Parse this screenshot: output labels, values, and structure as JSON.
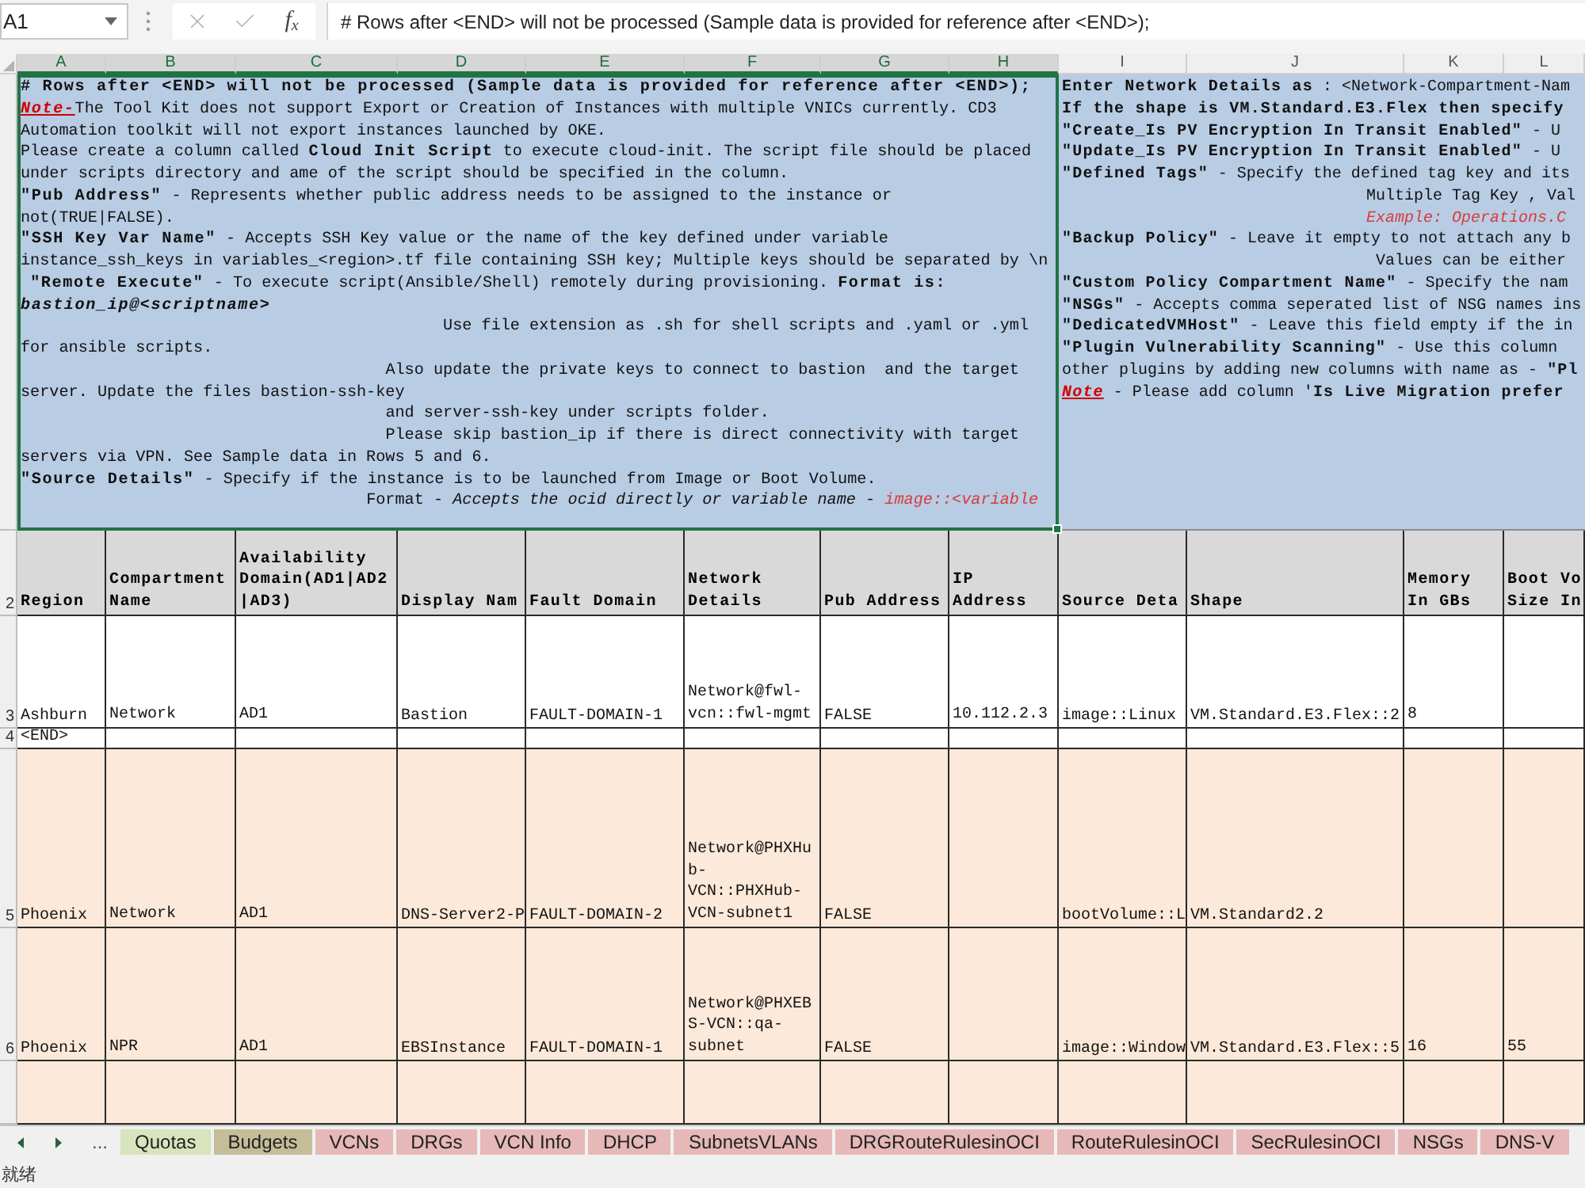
{
  "formula_bar": {
    "name_box": "A1",
    "editing": false,
    "function_label": "f$_{x}$",
    "formula": "# Rows after <END> will not be processed (Sample data is provided for reference after <END>);"
  },
  "columns": [
    {
      "letter": "A",
      "selected": true,
      "heading": "Region"
    },
    {
      "letter": "B",
      "selected": true,
      "wrap": true,
      "heading": "Compartment Name"
    },
    {
      "letter": "C",
      "selected": true,
      "wrap": true,
      "heading": "Availability Domain(AD1|AD2|AD3)"
    },
    {
      "letter": "D",
      "selected": true,
      "wrap": false,
      "heading": "Display Nam"
    },
    {
      "letter": "E",
      "selected": true,
      "heading": "Fault Domain"
    },
    {
      "letter": "F",
      "selected": true,
      "wrap": true,
      "heading": "Network Details"
    },
    {
      "letter": "G",
      "selected": true,
      "heading": "Pub Address"
    },
    {
      "letter": "H",
      "selected": true,
      "wrap": true,
      "heading": "IP Address"
    },
    {
      "letter": "I",
      "selected": false,
      "wrap": false,
      "heading": "Source Deta"
    },
    {
      "letter": "J",
      "selected": false,
      "heading": "Shape"
    },
    {
      "letter": "K",
      "selected": false,
      "wrap": true,
      "heading": "Memory In GBs"
    },
    {
      "letter": "L",
      "selected": false,
      "wrap": true,
      "heading": "Boot Vo Size In"
    }
  ],
  "notes": [
    {
      "selected": true,
      "wrap": true,
      "paragraphs": [
        {
          "runs": [
            {
              "kind": "heading",
              "text": "# Rows after <END> will not be processed (Sample data is provided for reference after <END>);"
            }
          ]
        },
        {
          "runs": [
            {
              "kind": "alert",
              "text": "Note-"
            },
            {
              "kind": "text",
              "text": "The Tool Kit does not support Export or Creation of Instances with multiple VNICs currently. CD3 Automation toolkit will not export instances launched by OKE."
            }
          ]
        },
        {
          "runs": [
            {
              "kind": "text",
              "text": "Please create a column called **Cloud Init Script** to execute cloud-init. The script file should be placed under scripts directory and ame of the script should be specified in the column."
            }
          ]
        },
        {
          "runs": [
            {
              "kind": "text",
              "text": "**\"Pub Address\"** - Represents whether public address needs to be assigned to the instance or not(TRUE|FALSE)."
            }
          ]
        },
        {
          "runs": [
            {
              "kind": "text",
              "text": "**\"SSH Key Var Name\"** - Accepts SSH Key value or the name of the key defined under variable instance_ssh_keys in variables_<region>.tf file containing SSH key; Multiple keys should be separated by \\n"
            }
          ]
        },
        {
          "runs": [
            {
              "kind": "text",
              "text": " **\"Remote Execute\"** - To execute script(Ansible/Shell) remotely during provisioning. **Format is:** "
            },
            {
              "kind": "emphasis",
              "text": "bastion_ip@<scriptname>"
            }
          ]
        },
        {
          "runs": [
            {
              "kind": "text",
              "text": "                                            Use file extension as .sh for shell scripts and .yaml or .yml for ansible scripts."
            }
          ]
        },
        {
          "runs": [
            {
              "kind": "text",
              "text": "                                      Also update the private keys to connect to bastion  and the target server. Update the files bastion-ssh-key"
            }
          ]
        },
        {
          "runs": [
            {
              "kind": "text",
              "text": "                                      and server-ssh-key under scripts folder."
            }
          ]
        },
        {
          "runs": [
            {
              "kind": "text",
              "text": "                                      Please skip bastion_ip if there is direct connectivity with target servers via VPN. See Sample data in Rows 5 and 6."
            }
          ]
        },
        {
          "runs": [
            {
              "kind": "text",
              "text": "**\"Source Details\"** - Specify if the instance is to be launched from Image or Boot Volume."
            }
          ]
        },
        {
          "runs": [
            {
              "kind": "text",
              "text": "                                    Format - *Accepts the ocid directly or variable name* - "
            },
            {
              "kind": "example",
              "text": "image::<variable"
            }
          ]
        }
      ]
    },
    {
      "selected": false,
      "wrap": false,
      "paragraphs": [
        {
          "runs": [
            {
              "kind": "text",
              "text": "**Enter Network Details as** : <Network-Compartment-Nam"
            }
          ]
        },
        {
          "runs": [
            {
              "kind": "heading",
              "text": "If the shape is VM.Standard.E3.Flex then specify"
            }
          ]
        },
        {
          "runs": [
            {
              "kind": "text",
              "text": "**\"Create_Is PV Encryption In Transit Enabled\"** - U"
            }
          ]
        },
        {
          "runs": [
            {
              "kind": "text",
              "text": "**\"Update_Is PV Encryption In Transit Enabled\"** - U"
            }
          ]
        },
        {
          "runs": [
            {
              "kind": "text",
              "text": "**\"Defined Tags\"** - Specify the defined tag key and its"
            }
          ]
        },
        {
          "runs": [
            {
              "kind": "text",
              "text": "                                Multiple Tag Key , Val"
            }
          ]
        },
        {
          "runs": [
            {
              "kind": "example",
              "text": "                                Example: Operations.C"
            }
          ]
        },
        {
          "runs": [
            {
              "kind": "text",
              "text": "**\"Backup Policy\"** - Leave it empty to not attach any b"
            }
          ]
        },
        {
          "runs": [
            {
              "kind": "text",
              "text": "                                 Values can be either"
            }
          ]
        },
        {
          "runs": [
            {
              "kind": "text",
              "text": "**\"Custom Policy Compartment Name\"** - Specify the nam"
            }
          ]
        },
        {
          "runs": [
            {
              "kind": "text",
              "text": "**\"NSGs\"** - Accepts comma seperated list of NSG names ins"
            }
          ]
        },
        {
          "runs": [
            {
              "kind": "text",
              "text": "**\"DedicatedVMHost\"** - Leave this field empty if the in"
            }
          ]
        },
        {
          "runs": [
            {
              "kind": "text",
              "text": "**\"Plugin Vulnerability Scanning\"** - Use this column"
            }
          ]
        },
        {
          "runs": [
            {
              "kind": "text",
              "text": "other plugins by adding new columns with name as - **\"Pl**"
            }
          ]
        },
        {
          "runs": [
            {
              "kind": "alert",
              "text": "Note"
            },
            {
              "kind": "text",
              "text": " - Please add column '**Is Live Migration prefer**"
            }
          ]
        }
      ]
    }
  ],
  "table": {
    "heading_row_number": "2",
    "rows": [
      {
        "number": "3",
        "color": "#ffffff",
        "cells": [
          "Ashburn",
          "Network",
          "AD1",
          "Bastion",
          "FAULT-DOMAIN-1",
          "Network@fwl-vcn::fwl-mgmt",
          "FALSE",
          "10.112.2.3",
          "image::Linux",
          "VM.Standard.E3.Flex::2",
          "8"
        ]
      },
      {
        "number": "4",
        "color": "#ffffff",
        "cells": [
          "<END>"
        ]
      },
      {
        "number": "5",
        "color": "#fde9d9",
        "cells": [
          "Phoenix",
          "Network",
          "AD1",
          "DNS-Server2-P",
          "FAULT-DOMAIN-2",
          "Network@PHXHub-VCN::PHXHub-VCN-subnet1",
          "FALSE",
          null,
          "bootVolume::L",
          "VM.Standard2.2"
        ]
      },
      {
        "number": "6",
        "color": "#fde9d9",
        "cells": [
          "Phoenix",
          "NPR",
          "AD1",
          "EBSInstance",
          "FAULT-DOMAIN-1",
          "Network@PHXEBS-VCN::qa-subnet",
          "FALSE",
          null,
          "image::Window",
          "VM.Standard.E3.Flex::5",
          "16",
          "55"
        ]
      },
      {
        "color": "#fde9d9"
      }
    ]
  },
  "tab_bar": {
    "more": "...",
    "tabs": [
      {
        "label": "Quotas",
        "color": "#d8e4bc",
        "selected": false
      },
      {
        "label": "Budgets",
        "color": "#c4bd97",
        "selected": false
      },
      {
        "label": "VCNs",
        "color": "#e6b8b7",
        "selected": false
      },
      {
        "label": "DRGs",
        "color": "#e6b8b7",
        "selected": false
      },
      {
        "label": "VCN Info",
        "color": "#e6b8b7",
        "selected": false
      },
      {
        "label": "DHCP",
        "color": "#e6b8b7",
        "selected": false
      },
      {
        "label": "SubnetsVLANs",
        "color": "#e6b8b7",
        "selected": false
      },
      {
        "label": "DRGRouteRulesinOCI",
        "color": "#e6b8b7",
        "selected": false
      },
      {
        "label": "RouteRulesinOCI",
        "color": "#e6b8b7",
        "selected": false
      },
      {
        "label": "SecRulesinOCI",
        "color": "#e6b8b7",
        "selected": false
      },
      {
        "label": "NSGs",
        "color": "#e6b8b7",
        "selected": false
      },
      {
        "label": "DNS-V",
        "color": "#e6b8b7",
        "selected": false
      }
    ]
  },
  "status_bar": {
    "text": "就绪"
  }
}
